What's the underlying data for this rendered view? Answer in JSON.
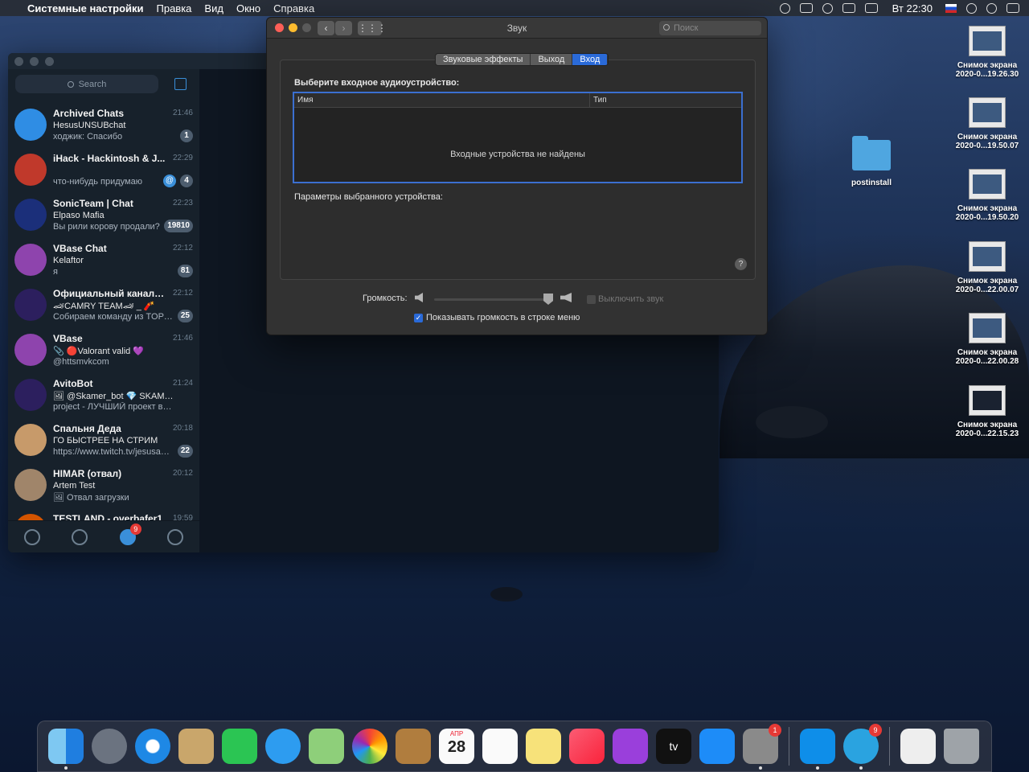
{
  "menubar": {
    "app": "Системные настройки",
    "items": [
      "Правка",
      "Вид",
      "Окно",
      "Справка"
    ],
    "clock": "Вт 22:30"
  },
  "telegram": {
    "search_placeholder": "Search",
    "chats": [
      {
        "name": "Archived Chats",
        "time": "21:46",
        "line1": "HesusUNSUBchat",
        "line2": "ходжик: Спасибо",
        "badge": "1",
        "color": "#2f8de4"
      },
      {
        "name": "iHack - Hackintosh & J...",
        "time": "22:29",
        "line1": "",
        "line2": "что-нибудь придумаю",
        "badge": "4",
        "mention": "@",
        "color": "#c0392b"
      },
      {
        "name": "SonicTeam | Chat",
        "time": "22:23",
        "line1": "Elpaso Mafia",
        "line2": "Вы рили корову продали?",
        "badge": "19810",
        "color": "#1b2f7a"
      },
      {
        "name": "VBase Chat",
        "time": "22:12",
        "line1": "Kelaftor",
        "line2": "я",
        "badge": "81",
        "color": "#8e44ad"
      },
      {
        "name": "Официальный канал -...",
        "time": "22:12",
        "line1": "🏎CAMRY TEAM🏎 _ 🧨",
        "line2": "Собираем команду из TOP B...",
        "badge": "25",
        "color": "#2c1f5e"
      },
      {
        "name": "VBase",
        "time": "21:46",
        "line1": "📎 🔴Valorant valid 💜",
        "line2": "@httsmvkcom",
        "badge": "",
        "color": "#8e44ad"
      },
      {
        "name": "AvitoBot",
        "time": "21:24",
        "line1": "🖼 @Skamer_bot 💎 SKAMER",
        "line2": "project - ЛУЧШИЙ проект в сво...",
        "badge": "",
        "color": "#2c1f5e"
      },
      {
        "name": "Спальня Деда",
        "time": "20:18",
        "line1": "ГО БЫСТРЕЕ НА СТРИМ",
        "line2": "https://www.twitch.tv/jesusavgn",
        "badge": "22",
        "color": "#c79a6a"
      },
      {
        "name": "HIMAR (отвал)",
        "time": "20:12",
        "line1": "Artem Test",
        "line2": "🖼 Отвал загрузки",
        "badge": "",
        "color": "#a0856a"
      },
      {
        "name": "TESTLAND - overbafer1",
        "time": "19:59",
        "line1": "",
        "line2": "",
        "badge": "",
        "color": "#d35400"
      }
    ],
    "bottom_badge": "9"
  },
  "prefs": {
    "title": "Звук",
    "search_placeholder": "Поиск",
    "tabs": [
      "Звуковые эффекты",
      "Выход",
      "Вход"
    ],
    "select_label": "Выберите входное аудиоустройство:",
    "col_name": "Имя",
    "col_type": "Тип",
    "empty_text": "Входные устройства не найдены",
    "params_label": "Параметры выбранного устройства:",
    "help": "?",
    "volume_label": "Громкость:",
    "mute_label": "Выключить звук",
    "show_volume_label": "Показывать громкость в строке меню"
  },
  "desktop": {
    "screenshots": [
      {
        "l1": "Снимок экрана",
        "l2": "2020-0...19.26.30"
      },
      {
        "l1": "Снимок экрана",
        "l2": "2020-0...19.50.07"
      },
      {
        "l1": "Снимок экрана",
        "l2": "2020-0...19.50.20"
      },
      {
        "l1": "Снимок экрана",
        "l2": "2020-0...22.00.07"
      },
      {
        "l1": "Снимок экрана",
        "l2": "2020-0...22.00.28"
      },
      {
        "l1": "Снимок экрана",
        "l2": "2020-0...22.15.23"
      }
    ],
    "folder": "postinstall"
  },
  "dock": {
    "calendar_month": "АПР",
    "calendar_day": "28",
    "appletv": "tv",
    "badges": {
      "system_prefs": "1",
      "telegram": "9"
    }
  }
}
